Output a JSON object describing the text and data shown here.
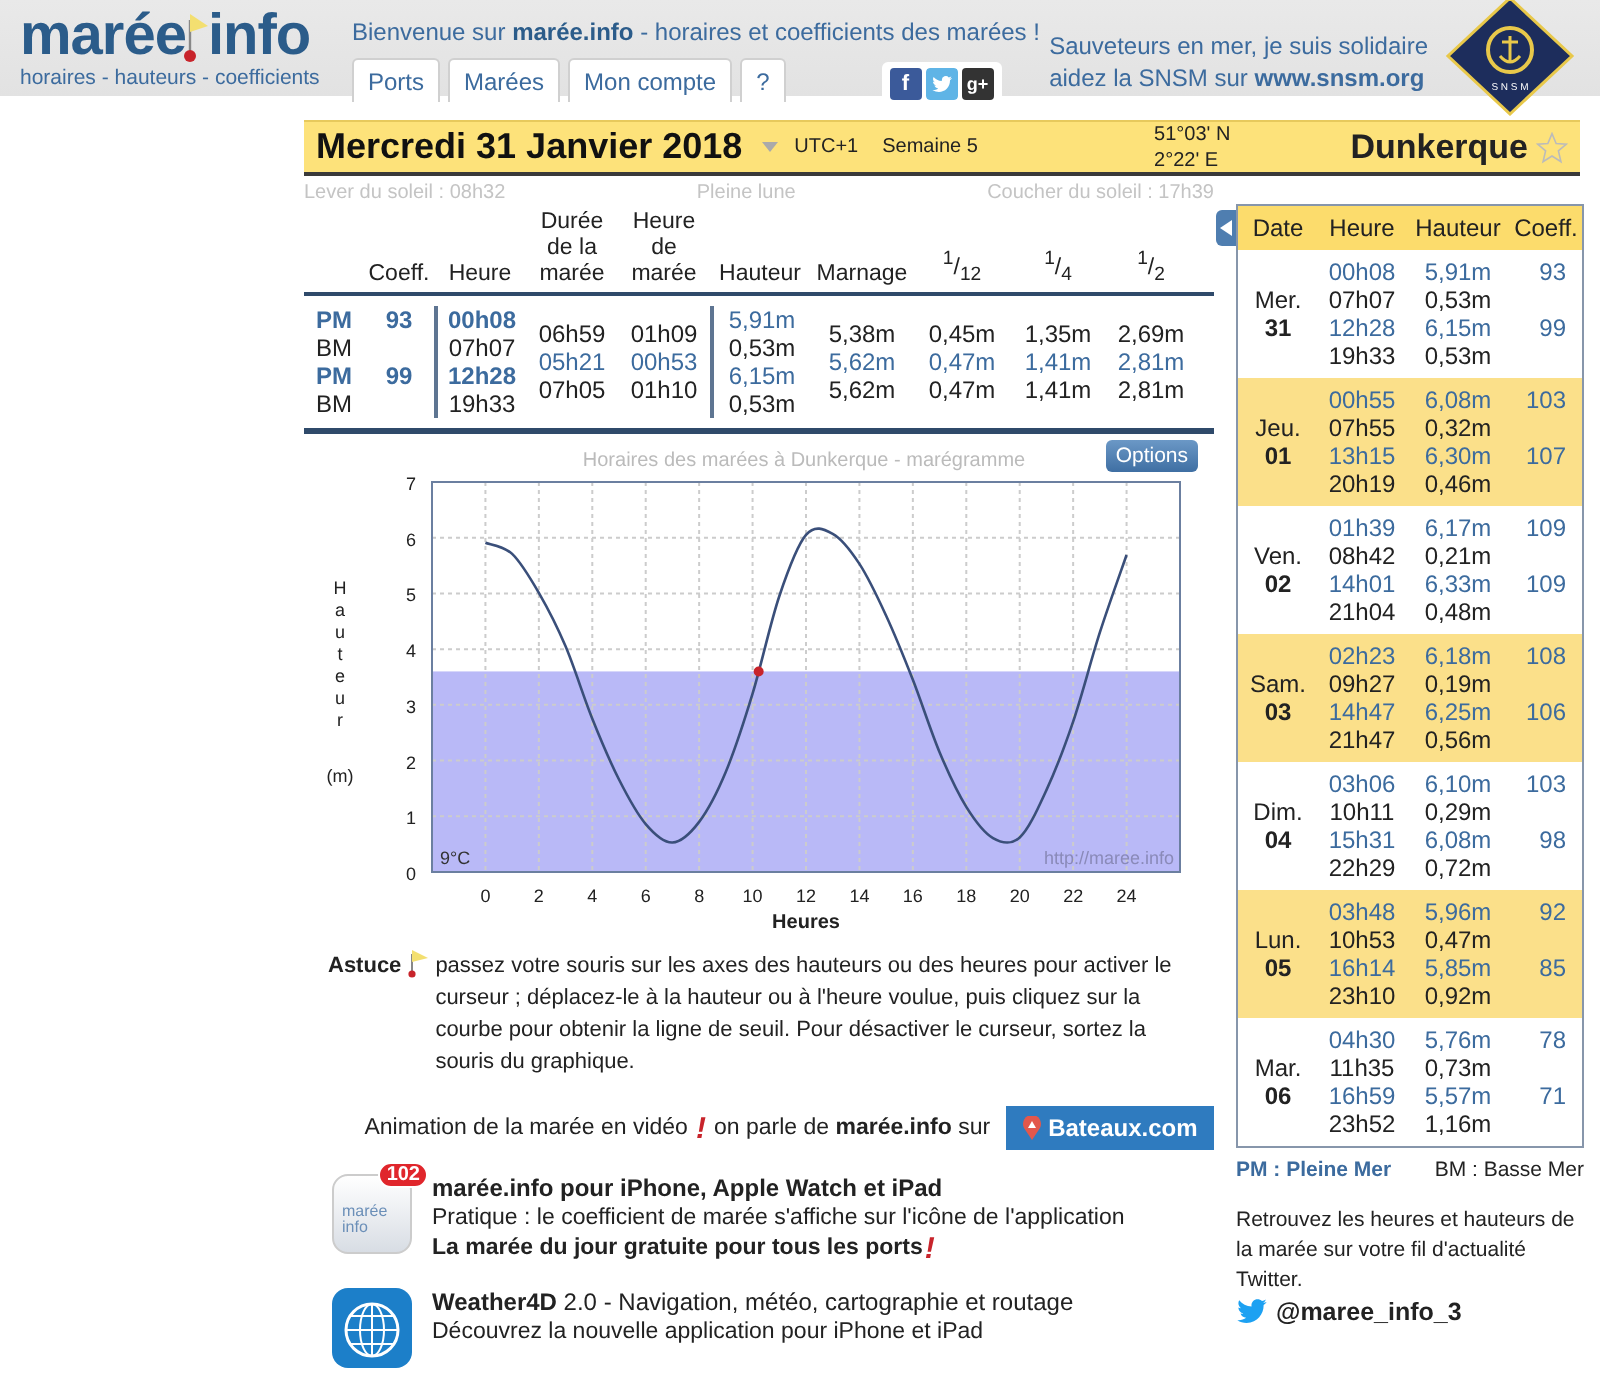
{
  "header": {
    "logo": {
      "left": "marée",
      "right": "info",
      "tagline": "horaires - hauteurs - coefficients"
    },
    "welcome": "Bienvenue sur **marée.info** - horaires et coefficients des marées !",
    "tabs": [
      {
        "label": "Ports"
      },
      {
        "label": "Marées"
      },
      {
        "label": "Mon compte"
      },
      {
        "label": "?"
      }
    ],
    "social": [
      {
        "kind": "facebook",
        "glyph": "f"
      },
      {
        "kind": "twitter"
      },
      {
        "kind": "googleplus",
        "glyph": "g+"
      }
    ],
    "snsm": {
      "lines": [
        "Sauveteurs en mer, je suis solidaire",
        "aidez la SNSM sur **www.snsm.org**"
      ],
      "badge": "S N S M"
    }
  },
  "date_bar": {
    "date": "Mercredi 31 Janvier 2018",
    "timezone": "UTC+1",
    "week": "Semaine 5",
    "latitude": "51°03' N",
    "longitude": "2°22' E",
    "port": "Dunkerque",
    "favorite": false
  },
  "sun": {
    "sunrise": "Lever du soleil : 08h32",
    "moon": "Pleine lune",
    "sunset": "Coucher du soleil : 17h39"
  },
  "tide_table": {
    "columns": [
      "Coeff.",
      "Heure",
      "Durée de la marée",
      "Heure de marée",
      "Hauteur",
      "Marnage",
      "$^{1}$/$_{12}$",
      "$^{1}$/$_{4}$",
      "$^{1}$/$_{2}$"
    ],
    "tides": [
      {
        "type": "PM",
        "high": true,
        "coeff": "93",
        "time": "00h08",
        "height": "5,91m"
      },
      {
        "type": "BM",
        "high": false,
        "time": "07h07",
        "height": "0,53m"
      },
      {
        "type": "PM",
        "high": true,
        "coeff": "99",
        "time": "12h28",
        "height": "6,15m"
      },
      {
        "type": "BM",
        "high": false,
        "time": "19h33",
        "height": "0,53m"
      }
    ],
    "intervals": [
      {
        "duration": "06h59",
        "tide_hour": "01h09",
        "range": "5,38m",
        "twelfth": "0,45m",
        "quarter": "1,35m",
        "half": "2,69m",
        "highlighted": false
      },
      {
        "duration": "05h21",
        "tide_hour": "00h53",
        "range": "5,62m",
        "twelfth": "0,47m",
        "quarter": "1,41m",
        "half": "2,81m",
        "highlighted": true
      },
      {
        "duration": "07h05",
        "tide_hour": "01h10",
        "range": "5,62m",
        "twelfth": "0,47m",
        "quarter": "1,41m",
        "half": "2,81m",
        "highlighted": false
      }
    ]
  },
  "tide_chart": {
    "options_button": "Options",
    "temperature": "9°C",
    "credit": "http://maree.info",
    "yunit": "(m)",
    "chart_data": {
      "type": "line",
      "title": "Horaires des marées à Dunkerque - marégramme",
      "xlabel": "Heures",
      "ylabel": "Hauteur",
      "x": [
        0,
        1,
        2,
        3,
        4,
        5,
        6,
        7,
        8,
        9,
        10,
        11,
        12,
        13,
        14,
        15,
        16,
        17,
        18,
        19,
        20,
        21,
        22,
        23,
        24
      ],
      "series": [
        {
          "color": "#3a4f7a",
          "values": [
            5.91,
            5.71,
            5.01,
            4.05,
            2.75,
            1.66,
            0.86,
            0.53,
            0.9,
            1.8,
            3.2,
            4.95,
            6.05,
            6.07,
            5.53,
            4.6,
            3.45,
            2.15,
            1.17,
            0.61,
            0.62,
            1.47,
            2.7,
            4.3,
            5.69
          ]
        }
      ],
      "xlim": [
        -2,
        26
      ],
      "ylim": [
        0,
        7
      ],
      "xticks": [
        0,
        2,
        4,
        6,
        8,
        10,
        12,
        14,
        16,
        18,
        20,
        22,
        24
      ],
      "yticks": [
        0,
        1,
        2,
        3,
        4,
        5,
        6,
        7
      ],
      "grid": true,
      "bands": [
        {
          "axis": "y",
          "from": 0,
          "to": 3.6,
          "color": "#b9b9f7"
        }
      ]
    }
  },
  "tip": {
    "label": "Astuce",
    "text": "passez votre souris sur les axes des hauteurs ou des heures pour activer le curseur ; déplacez-le à la hauteur ou à l'heure voulue, puis cliquez sur la courbe pour obtenir la ligne de seuil. Pour désactiver le curseur, sortez la souris du graphique."
  },
  "video": {
    "text_before": "Animation de la marée en vidéo",
    "mark": "!",
    "text_after": "on parle de **marée.info** sur",
    "button": "Bateaux.com"
  },
  "apps": [
    {
      "kind": "maree",
      "icon_text": "marée info",
      "badge": "102",
      "title": "marée.info pour iPhone, Apple Watch et iPad",
      "lines": [
        "Pratique : le coefficient de marée s'affiche sur l'icône de l'application"
      ],
      "highlight": "La marée du jour gratuite pour tous les ports",
      "mark": "!"
    },
    {
      "kind": "weather",
      "title": "**Weather4D** 2.0 - Navigation, météo, cartographie et routage",
      "lines": [
        "Découvrez la nouvelle application pour iPhone et iPad"
      ]
    }
  ],
  "week_panel": {
    "columns": [
      "Date",
      "Heure",
      "Hauteur",
      "Coeff."
    ],
    "days": [
      {
        "day": "Mer.",
        "date": "31",
        "shaded": false,
        "tides": [
          {
            "time": "00h08",
            "height": "5,91m",
            "coeff": "93",
            "high": true
          },
          {
            "time": "07h07",
            "height": "0,53m",
            "high": false
          },
          {
            "time": "12h28",
            "height": "6,15m",
            "coeff": "99",
            "high": true
          },
          {
            "time": "19h33",
            "height": "0,53m",
            "high": false
          }
        ]
      },
      {
        "day": "Jeu.",
        "date": "01",
        "shaded": true,
        "tides": [
          {
            "time": "00h55",
            "height": "6,08m",
            "coeff": "103",
            "high": true
          },
          {
            "time": "07h55",
            "height": "0,32m",
            "high": false
          },
          {
            "time": "13h15",
            "height": "6,30m",
            "coeff": "107",
            "high": true
          },
          {
            "time": "20h19",
            "height": "0,46m",
            "high": false
          }
        ]
      },
      {
        "day": "Ven.",
        "date": "02",
        "shaded": false,
        "tides": [
          {
            "time": "01h39",
            "height": "6,17m",
            "coeff": "109",
            "high": true
          },
          {
            "time": "08h42",
            "height": "0,21m",
            "high": false
          },
          {
            "time": "14h01",
            "height": "6,33m",
            "coeff": "109",
            "high": true
          },
          {
            "time": "21h04",
            "height": "0,48m",
            "high": false
          }
        ]
      },
      {
        "day": "Sam.",
        "date": "03",
        "shaded": true,
        "tides": [
          {
            "time": "02h23",
            "height": "6,18m",
            "coeff": "108",
            "high": true
          },
          {
            "time": "09h27",
            "height": "0,19m",
            "high": false
          },
          {
            "time": "14h47",
            "height": "6,25m",
            "coeff": "106",
            "high": true
          },
          {
            "time": "21h47",
            "height": "0,56m",
            "high": false
          }
        ]
      },
      {
        "day": "Dim.",
        "date": "04",
        "shaded": false,
        "tides": [
          {
            "time": "03h06",
            "height": "6,10m",
            "coeff": "103",
            "high": true
          },
          {
            "time": "10h11",
            "height": "0,29m",
            "high": false
          },
          {
            "time": "15h31",
            "height": "6,08m",
            "coeff": "98",
            "high": true
          },
          {
            "time": "22h29",
            "height": "0,72m",
            "high": false
          }
        ]
      },
      {
        "day": "Lun.",
        "date": "05",
        "shaded": true,
        "tides": [
          {
            "time": "03h48",
            "height": "5,96m",
            "coeff": "92",
            "high": true
          },
          {
            "time": "10h53",
            "height": "0,47m",
            "high": false
          },
          {
            "time": "16h14",
            "height": "5,85m",
            "coeff": "85",
            "high": true
          },
          {
            "time": "23h10",
            "height": "0,92m",
            "high": false
          }
        ]
      },
      {
        "day": "Mar.",
        "date": "06",
        "shaded": false,
        "tides": [
          {
            "time": "04h30",
            "height": "5,76m",
            "coeff": "78",
            "high": true
          },
          {
            "time": "11h35",
            "height": "0,73m",
            "high": false
          },
          {
            "time": "16h59",
            "height": "5,57m",
            "coeff": "71",
            "high": true
          },
          {
            "time": "23h52",
            "height": "1,16m",
            "high": false
          }
        ]
      }
    ]
  },
  "legend": {
    "high": "PM : Pleine Mer",
    "low": "BM : Basse Mer"
  },
  "twitter": {
    "text": "Retrouvez les heures et hauteurs de la marée sur votre fil d'actualité Twitter.",
    "handle": "@maree_info_3"
  }
}
